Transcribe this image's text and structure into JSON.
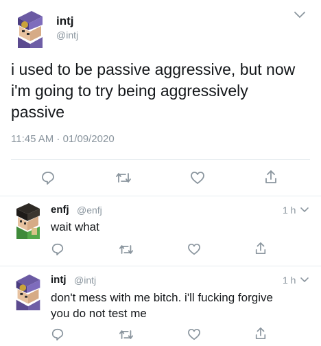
{
  "main_tweet": {
    "display_name": "intj",
    "handle": "@intj",
    "text_line1": "i used to be passive aggressive, but now",
    "text_line2": "i'm going to try being aggressively",
    "text_line3": "passive",
    "timestamp": "11:45 AM · 01/09/2020"
  },
  "replies": [
    {
      "display_name": "enfj",
      "handle": "@enfj",
      "time": "1 h",
      "text_line1": "wait what",
      "text_line2": ""
    },
    {
      "display_name": "intj",
      "handle": "@intj",
      "time": "1 h",
      "text_line1": "don't mess with me bitch. i'll fucking forgive",
      "text_line2": "you do not test me"
    }
  ],
  "icons": {
    "reply": "reply-icon",
    "retweet": "retweet-icon",
    "like": "like-icon",
    "share": "share-icon",
    "menu": "chevron-down-icon"
  },
  "colors": {
    "text": "#14171a",
    "muted": "#8a959e",
    "divider": "#e6ecf0"
  }
}
